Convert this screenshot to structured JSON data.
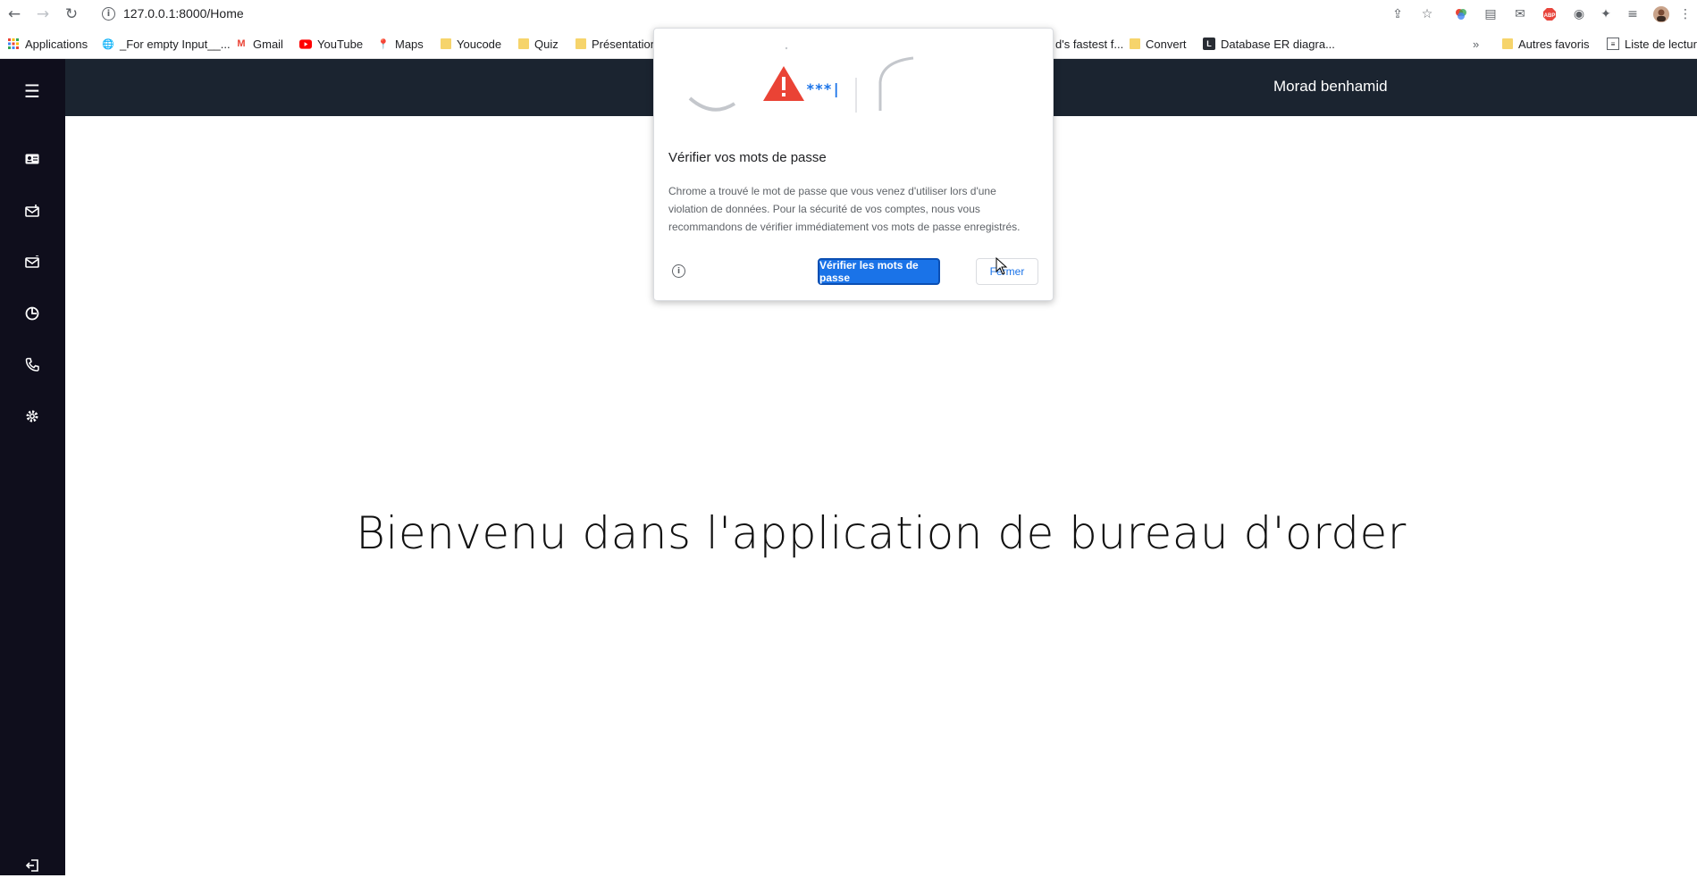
{
  "browser": {
    "url": "127.0.0.1:8000/Home",
    "bookmarks": [
      {
        "label": "Applications",
        "icon": "apps-grid-icon"
      },
      {
        "label": "_For empty Input__...",
        "icon": "globe-icon"
      },
      {
        "label": "Gmail",
        "icon": "gmail-icon"
      },
      {
        "label": "YouTube",
        "icon": "youtube-icon"
      },
      {
        "label": "Maps",
        "icon": "maps-pin-icon"
      },
      {
        "label": "Youcode",
        "icon": "folder-icon"
      },
      {
        "label": "Quiz",
        "icon": "folder-icon"
      },
      {
        "label": "Présentation",
        "icon": "folder-icon"
      },
      {
        "label": "d's fastest f...",
        "icon": "page-icon"
      },
      {
        "label": "Convert",
        "icon": "folder-icon"
      },
      {
        "label": "Database ER diagra...",
        "icon": "lucid-icon"
      },
      {
        "label": "Autres favoris",
        "icon": "folder-icon"
      },
      {
        "label": "Liste de lecture",
        "icon": "reading-list-icon"
      }
    ],
    "overflow_label": "»"
  },
  "app": {
    "user_name": "Morad benhamid",
    "welcome": "Bienvenu dans l'application de bureau d'order",
    "sidebar_icons": [
      "menu-icon",
      "id-card-icon",
      "mail-in-icon",
      "mail-out-icon",
      "chart-pie-icon",
      "phone-icon",
      "settings-icon",
      "logout-icon"
    ]
  },
  "dialog": {
    "title": "Vérifier vos mots de passe",
    "body": "Chrome a trouvé le mot de passe que vous venez d'utiliser lors d'une violation de données. Pour la sécurité de vos comptes, nous vous recommandons de vérifier immédiatement vos mots de passe enregistrés.",
    "primary_button": "Vérifier les mots de passe",
    "secondary_button": "Fermer",
    "art_password_mask": "***|"
  },
  "colors": {
    "sidebar_bg": "#0f0e1c",
    "topbar_bg": "#1b2430",
    "primary_blue": "#1a73e8",
    "warning_red": "#ea4335"
  }
}
